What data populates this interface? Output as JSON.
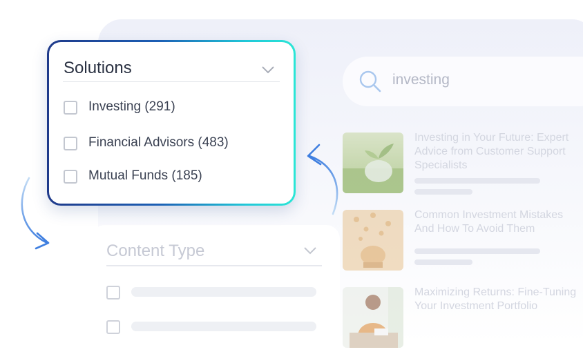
{
  "search": {
    "query": "investing"
  },
  "results": [
    {
      "title": "Investing in Your Future: Expert\nAdvice from Customer Support\nSpecialists"
    },
    {
      "title": "Common Investment Mistakes\nAnd How To Avoid Them"
    },
    {
      "title": "Maximizing Returns: Fine-Tuning\nYour Investment Portfolio"
    }
  ],
  "solutions_filter": {
    "title": "Solutions",
    "options": [
      {
        "label": "Investing",
        "count": "(291)"
      },
      {
        "label": "Financial Advisors",
        "count": "(483)"
      },
      {
        "label": "Mutual Funds",
        "count": "(185)"
      }
    ]
  },
  "content_type_filter": {
    "title": "Content Type"
  },
  "colors": {
    "gradient_start": "#1f3a8a",
    "gradient_end": "#2be6d6",
    "arrow": "#3f7fe0"
  },
  "icons": [
    "search-icon",
    "chevron-down-icon",
    "curved-arrow-icon"
  ]
}
